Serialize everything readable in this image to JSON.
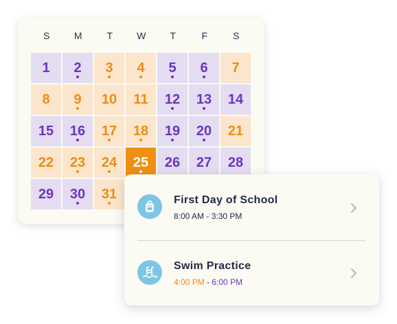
{
  "calendar": {
    "weekdays": [
      "S",
      "M",
      "T",
      "W",
      "T",
      "F",
      "S"
    ],
    "days": [
      {
        "label": "1",
        "color": "purple",
        "dot": false
      },
      {
        "label": "2",
        "color": "purple",
        "dot": true
      },
      {
        "label": "3",
        "color": "orange",
        "dot": true
      },
      {
        "label": "4",
        "color": "orange",
        "dot": true
      },
      {
        "label": "5",
        "color": "purple",
        "dot": true
      },
      {
        "label": "6",
        "color": "purple",
        "dot": true
      },
      {
        "label": "7",
        "color": "orange",
        "dot": false
      },
      {
        "label": "8",
        "color": "orange",
        "dot": false
      },
      {
        "label": "9",
        "color": "orange",
        "dot": true
      },
      {
        "label": "10",
        "color": "orange",
        "dot": false
      },
      {
        "label": "11",
        "color": "orange",
        "dot": false
      },
      {
        "label": "12",
        "color": "purple",
        "dot": true
      },
      {
        "label": "13",
        "color": "purple",
        "dot": true
      },
      {
        "label": "14",
        "color": "purple",
        "dot": false
      },
      {
        "label": "15",
        "color": "purple",
        "dot": false
      },
      {
        "label": "16",
        "color": "purple",
        "dot": true
      },
      {
        "label": "17",
        "color": "orange",
        "dot": true
      },
      {
        "label": "18",
        "color": "orange",
        "dot": true
      },
      {
        "label": "19",
        "color": "purple",
        "dot": true
      },
      {
        "label": "20",
        "color": "purple",
        "dot": true
      },
      {
        "label": "21",
        "color": "orange",
        "dot": false
      },
      {
        "label": "22",
        "color": "orange",
        "dot": false
      },
      {
        "label": "23",
        "color": "orange",
        "dot": true
      },
      {
        "label": "24",
        "color": "orange",
        "dot": true
      },
      {
        "label": "25",
        "color": "today",
        "dot": true
      },
      {
        "label": "26",
        "color": "purple",
        "dot": false
      },
      {
        "label": "27",
        "color": "purple",
        "dot": false
      },
      {
        "label": "28",
        "color": "purple",
        "dot": false
      },
      {
        "label": "29",
        "color": "purple",
        "dot": false
      },
      {
        "label": "30",
        "color": "purple",
        "dot": true
      },
      {
        "label": "31",
        "color": "orange",
        "dot": true
      }
    ]
  },
  "events": [
    {
      "title": "First Day of School",
      "icon": "backpack-icon",
      "time_parts": [
        {
          "text": "8:00 AM - 3:30 PM",
          "color": "#1f2a44"
        }
      ]
    },
    {
      "title": "Swim Practice",
      "icon": "swimming-pool-icon",
      "time_parts": [
        {
          "text": "4:00 PM",
          "color": "#ef8c12"
        },
        {
          "text": " - ",
          "color": "#1f2a44"
        },
        {
          "text": "6:00 PM",
          "color": "#6a35c2"
        }
      ]
    }
  ],
  "colors": {
    "purple_bg": "#e4dcf1",
    "purple_text": "#6a35c2",
    "orange_bg": "#fbe6cd",
    "orange_text": "#ef8c12",
    "today_bg": "#f09012",
    "icon_bg": "#7cc6e4"
  }
}
